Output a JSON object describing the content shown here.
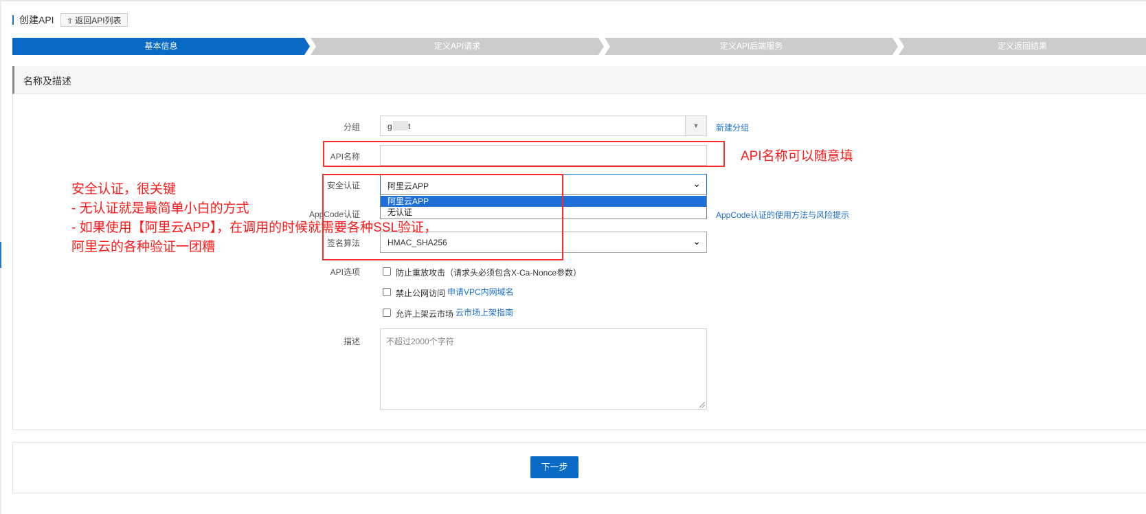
{
  "header": {
    "title": "创建API",
    "back_button_label": "返回API列表",
    "back_icon": "upload-arrow-icon"
  },
  "steps": [
    {
      "label": "基本信息",
      "active": true
    },
    {
      "label": "定义API请求",
      "active": false
    },
    {
      "label": "定义API后端服务",
      "active": false
    },
    {
      "label": "定义返回结果",
      "active": false
    }
  ],
  "section": {
    "title": "名称及描述"
  },
  "form": {
    "group": {
      "label": "分组",
      "value": "g matt",
      "new_group_link": "新建分组"
    },
    "api_name": {
      "label": "API名称",
      "value": ""
    },
    "security": {
      "label": "安全认证",
      "value": "阿里云APP",
      "options": [
        "阿里云APP",
        "无认证"
      ]
    },
    "appcode": {
      "label": "AppCode认证",
      "help_link": "AppCode认证的使用方法与风险提示"
    },
    "signature": {
      "label": "签名算法",
      "value": "HMAC_SHA256"
    },
    "api_options": {
      "label": "API选项",
      "replay": {
        "label": "防止重放攻击（请求头必须包含X-Ca-Nonce参数）",
        "checked": false
      },
      "no_public": {
        "label": "禁止公网访问",
        "link": "申请VPC内网域名",
        "checked": false
      },
      "market": {
        "label": "允许上架云市场",
        "link": "云市场上架指南",
        "checked": false
      }
    },
    "description": {
      "label": "描述",
      "placeholder": "不超过2000个字符"
    }
  },
  "footer": {
    "next_button": "下一步"
  },
  "annotations": {
    "api_name_note": "API名称可以随意填",
    "security_note": [
      "安全认证，很关键",
      "- 无认证就是最简单小白的方式",
      "- 如果使用【阿里云APP】，在调用的时候就需要各种SSL验证，",
      "阿里云的各种验证一团糟"
    ]
  },
  "colors": {
    "accent": "#0a6bc6",
    "link": "#1a6fc8",
    "annotation_red": "#ff1a1a",
    "step_inactive": "#cccccc"
  }
}
